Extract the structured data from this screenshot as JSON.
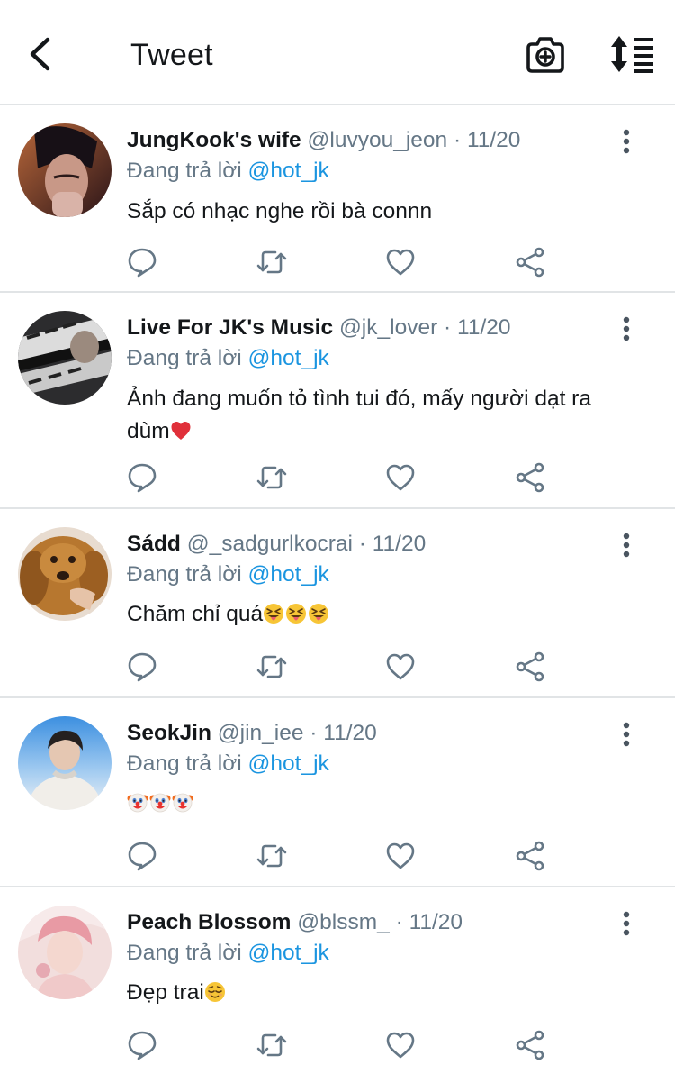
{
  "header": {
    "title": "Tweet",
    "back_icon": "chevron-left-icon",
    "camera_icon": "camera-plus-icon",
    "sort_icon": "sort-list-icon"
  },
  "colors": {
    "text": "#14171a",
    "secondary": "#657786",
    "link": "#1b95e0",
    "divider": "#e1e4e6"
  },
  "tweets": [
    {
      "name": "JungKook's wife",
      "handle": "@luvyou_jeon",
      "separator": "·",
      "date": "11/20",
      "reply_prefix": "Đang trả lời",
      "reply_to": "@hot_jk",
      "text": "Sắp có nhạc nghe rồi bà connn",
      "emojis": []
    },
    {
      "name": "Live For JK's Music",
      "handle": "@jk_lover",
      "separator": "·",
      "date": "11/20",
      "reply_prefix": "Đang trả lời",
      "reply_to": "@hot_jk",
      "text": "Ảnh đang muốn tỏ tình tui đó, mấy người dạt ra dùm",
      "emojis": [
        "red-heart"
      ]
    },
    {
      "name": "Sádd",
      "handle": "@_sadgurlkocrai",
      "separator": "·",
      "date": "11/20",
      "reply_prefix": "Đang trả lời",
      "reply_to": "@hot_jk",
      "text": "Chăm chỉ quá",
      "emojis": [
        "squinting-tongue-face",
        "squinting-tongue-face",
        "squinting-tongue-face"
      ]
    },
    {
      "name": "SeokJin",
      "handle": "@jin_iee",
      "separator": "·",
      "date": "11/20",
      "reply_prefix": "Đang trả lời",
      "reply_to": "@hot_jk",
      "text": "",
      "emojis": [
        "clown-face",
        "clown-face",
        "clown-face"
      ]
    },
    {
      "name": "Peach Blossom",
      "handle": "@blssm_",
      "separator": "·",
      "date": "11/20",
      "reply_prefix": "Đang trả lời",
      "reply_to": "@hot_jk",
      "text": "Đẹp trai",
      "emojis": [
        "relieved-face"
      ]
    }
  ],
  "action_icons": [
    "reply-icon",
    "retweet-icon",
    "like-icon",
    "share-icon"
  ]
}
